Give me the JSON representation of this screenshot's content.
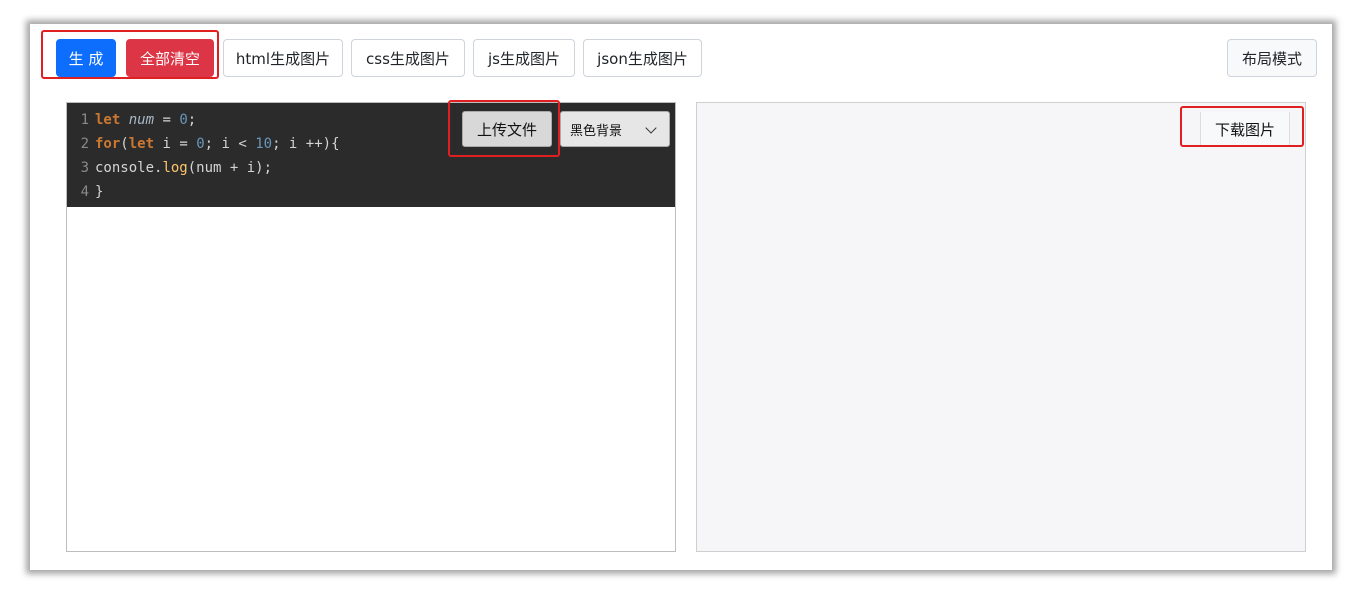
{
  "toolbar": {
    "generate_label": "生 成",
    "clear_all_label": "全部清空",
    "html_to_image_label": "html生成图片",
    "css_to_image_label": "css生成图片",
    "js_to_image_label": "js生成图片",
    "json_to_image_label": "json生成图片",
    "layout_mode_label": "布局模式"
  },
  "editor": {
    "upload_label": "上传文件",
    "background_select": {
      "selected": "黑色背景"
    },
    "code_lines": [
      {
        "n": "1",
        "text": "let num = 0;"
      },
      {
        "n": "2",
        "text": "for(let i = 0; i < 10; i ++){"
      },
      {
        "n": "3",
        "text": "console.log(num + i);"
      },
      {
        "n": "4",
        "text": "}"
      }
    ]
  },
  "preview": {
    "download_label": "下载图片"
  },
  "colors": {
    "primary": "#0d6efd",
    "danger": "#dc3545",
    "highlight": "#e02020",
    "editor_bg": "#2b2b2b"
  }
}
